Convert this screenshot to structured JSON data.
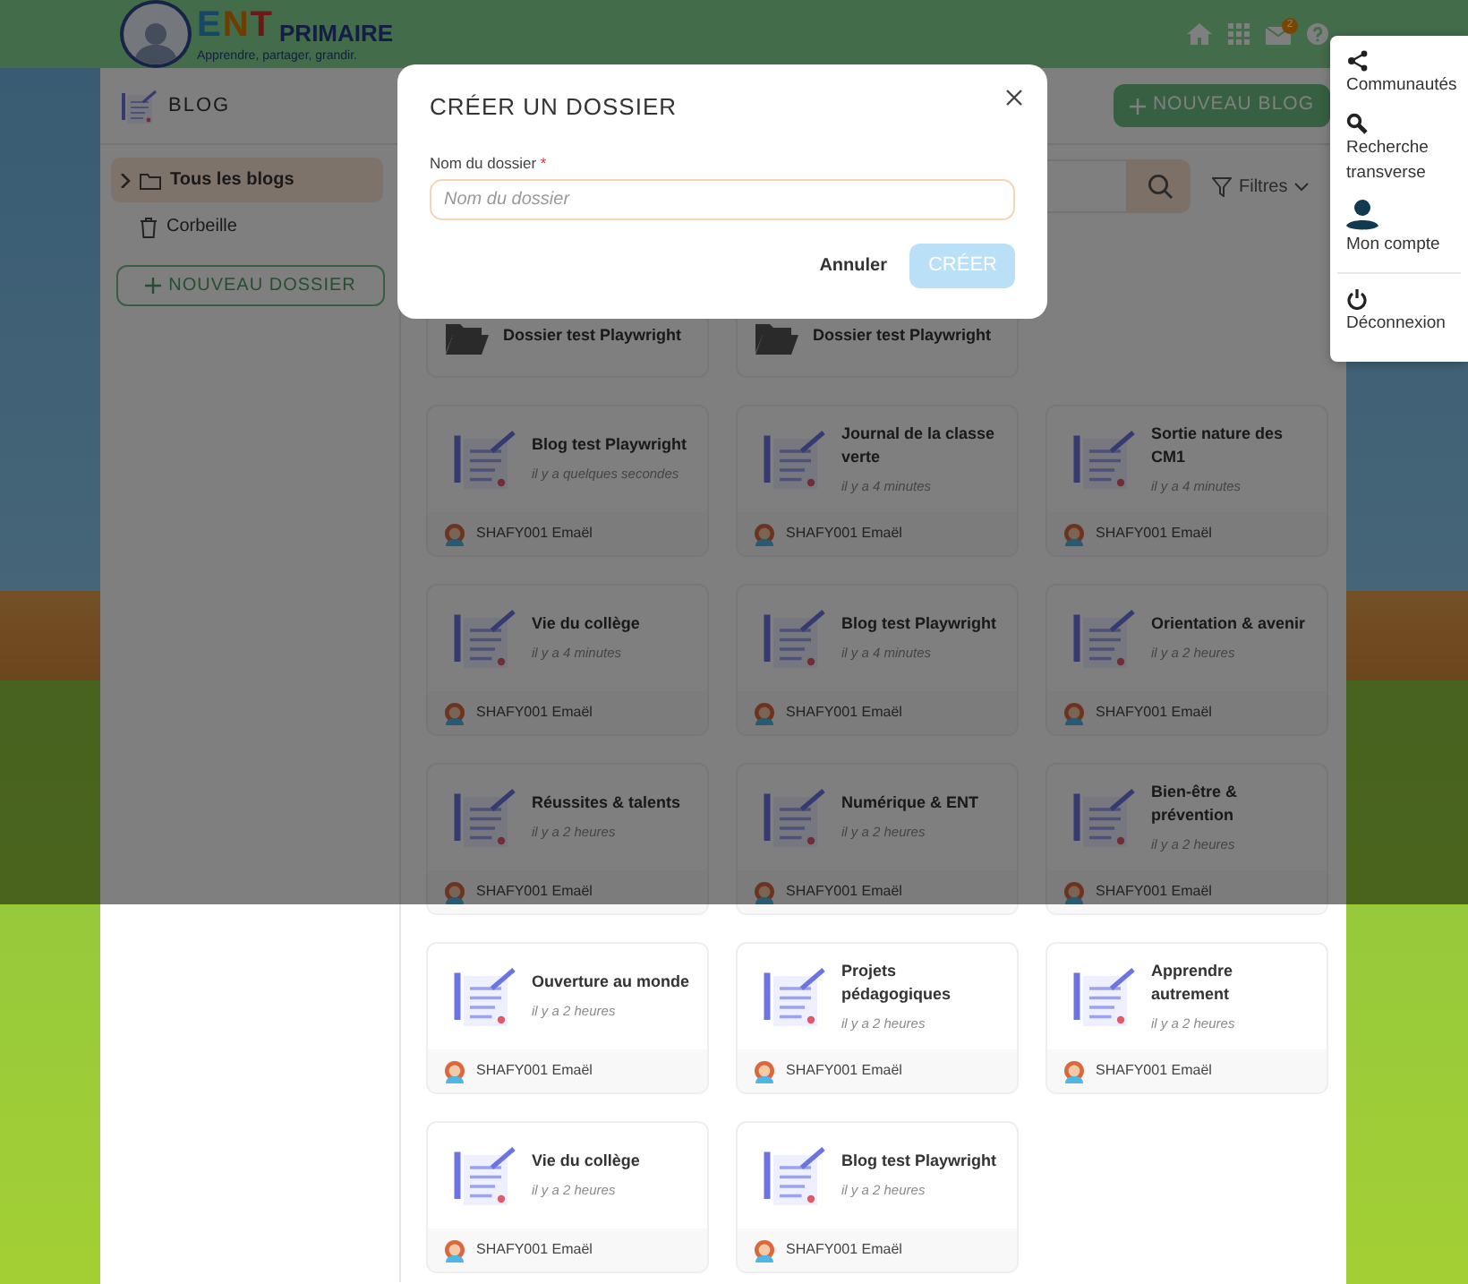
{
  "header": {
    "brand": "ENT",
    "brand_suffix": "PRIMAIRE",
    "tagline": "Apprendre, partager, grandir.",
    "nav_icons": [
      {
        "kind": "home"
      },
      {
        "kind": "apps"
      },
      {
        "kind": "mail",
        "badge": "2"
      },
      {
        "kind": "help"
      }
    ]
  },
  "page": {
    "title": "BLOG",
    "new_blog_button": "NOUVEAU BLOG"
  },
  "sidebar": {
    "items": [
      {
        "label": "Tous les blogs",
        "kind": "folder",
        "expandable": true,
        "selected": true
      },
      {
        "label": "Corbeille",
        "kind": "trash",
        "expandable": false,
        "selected": false
      }
    ],
    "new_folder_button": "NOUVEAU DOSSIER"
  },
  "toolbar": {
    "filter_label": "Filtres"
  },
  "folders": [
    {
      "name": "Dossier test Playwright"
    },
    {
      "name": "Dossier test Playwright"
    }
  ],
  "blogs": [
    {
      "title": "Blog test Playwright",
      "time": "il y a quelques secondes",
      "author": "SHAFY001 Emaël"
    },
    {
      "title": "Journal de la classe verte",
      "time": "il y a 4 minutes",
      "author": "SHAFY001 Emaël"
    },
    {
      "title": "Sortie nature des CM1",
      "time": "il y a 4 minutes",
      "author": "SHAFY001 Emaël"
    },
    {
      "title": "Vie du collège",
      "time": "il y a 4 minutes",
      "author": "SHAFY001 Emaël"
    },
    {
      "title": "Blog test Playwright",
      "time": "il y a 4 minutes",
      "author": "SHAFY001 Emaël"
    },
    {
      "title": "Orientation & avenir",
      "time": "il y a 2 heures",
      "author": "SHAFY001 Emaël"
    },
    {
      "title": "Réussites & talents",
      "time": "il y a 2 heures",
      "author": "SHAFY001 Emaël"
    },
    {
      "title": "Numérique & ENT",
      "time": "il y a 2 heures",
      "author": "SHAFY001 Emaël"
    },
    {
      "title": "Bien-être & prévention",
      "time": "il y a 2 heures",
      "author": "SHAFY001 Emaël"
    },
    {
      "title": "Ouverture au monde",
      "time": "il y a 2 heures",
      "author": "SHAFY001 Emaël"
    },
    {
      "title": "Projets pédagogiques",
      "time": "il y a 2 heures",
      "author": "SHAFY001 Emaël"
    },
    {
      "title": "Apprendre autrement",
      "time": "il y a 2 heures",
      "author": "SHAFY001 Emaël"
    },
    {
      "title": "Vie du collège",
      "time": "il y a 2 heures",
      "author": "SHAFY001 Emaël"
    },
    {
      "title": "Blog test Playwright",
      "time": "il y a 2 heures",
      "author": "SHAFY001 Emaël"
    }
  ],
  "modal": {
    "title": "CRÉER UN DOSSIER",
    "field_label": "Nom du dossier",
    "required_mark": "*",
    "placeholder": "Nom du dossier",
    "cancel_button": "Annuler",
    "submit_button": "CRÉER",
    "submit_disabled": true
  },
  "user_menu": {
    "items": [
      {
        "kind": "communities",
        "label": "Communautés",
        "divider_before": false
      },
      {
        "kind": "search",
        "label": "Recherche transverse",
        "divider_before": false
      },
      {
        "kind": "account",
        "label": "Mon compte",
        "divider_before": false
      },
      {
        "kind": "logout",
        "label": "Déconnexion",
        "divider_before": true
      }
    ]
  }
}
